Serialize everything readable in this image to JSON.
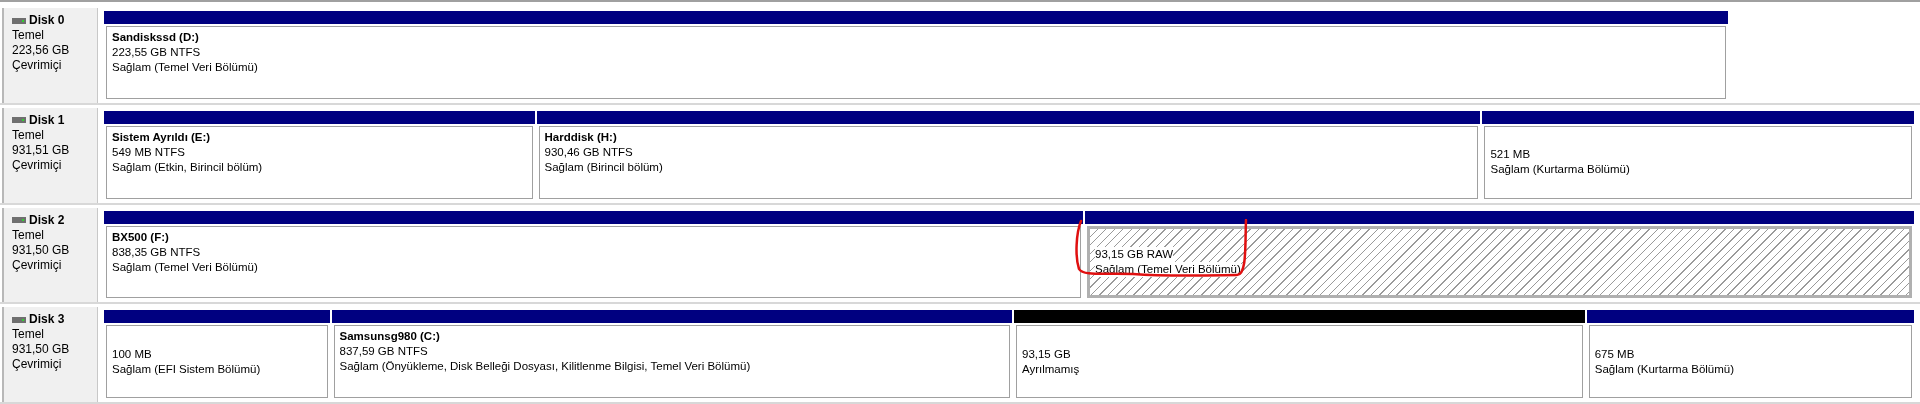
{
  "disks": [
    {
      "name": "Disk 0",
      "type": "Temel",
      "size": "223,56 GB",
      "status": "Çevrimiçi",
      "partitions": [
        {
          "kind": "primary",
          "selected": false,
          "name": "Sandiskssd  (D:)",
          "detail": "223,55 GB NTFS",
          "health": "Sağlam (Temel Veri Bölümü)"
        }
      ]
    },
    {
      "name": "Disk 1",
      "type": "Temel",
      "size": "931,51 GB",
      "status": "Çevrimiçi",
      "partitions": [
        {
          "kind": "primary",
          "selected": false,
          "name": "Sistem Ayrıldı  (E:)",
          "detail": "549 MB NTFS",
          "health": "Sağlam (Etkin, Birincil bölüm)"
        },
        {
          "kind": "primary",
          "selected": false,
          "name": "Harddisk  (H:)",
          "detail": "930,46 GB NTFS",
          "health": "Sağlam (Birincil bölüm)"
        },
        {
          "kind": "primary",
          "selected": false,
          "detail": "521 MB",
          "health": "Sağlam (Kurtarma Bölümü)"
        }
      ]
    },
    {
      "name": "Disk 2",
      "type": "Temel",
      "size": "931,50 GB",
      "status": "Çevrimiçi",
      "partitions": [
        {
          "kind": "primary",
          "selected": false,
          "name": "BX500  (F:)",
          "detail": "838,35 GB NTFS",
          "health": "Sağlam (Temel Veri Bölümü)"
        },
        {
          "kind": "primary",
          "selected": true,
          "detail": "93,15 GB RAW",
          "health": "Sağlam (Temel Veri Bölümü)"
        }
      ]
    },
    {
      "name": "Disk 3",
      "type": "Temel",
      "size": "931,50 GB",
      "status": "Çevrimiçi",
      "partitions": [
        {
          "kind": "primary",
          "selected": false,
          "detail": "100 MB",
          "health": "Sağlam (EFI Sistem Bölümü)"
        },
        {
          "kind": "primary",
          "selected": false,
          "name": "Samsunsg980  (C:)",
          "detail": "837,59 GB NTFS",
          "health": "Sağlam (Önyükleme, Disk Belleği Dosyası, Kilitlenme Bilgisi, Temel Veri Bölümü)"
        },
        {
          "kind": "unallocated",
          "selected": false,
          "detail": "93,15 GB",
          "health": "Ayrılmamış"
        },
        {
          "kind": "primary",
          "selected": false,
          "detail": "675 MB",
          "health": "Sağlam (Kurtarma Bölümü)"
        }
      ]
    }
  ]
}
